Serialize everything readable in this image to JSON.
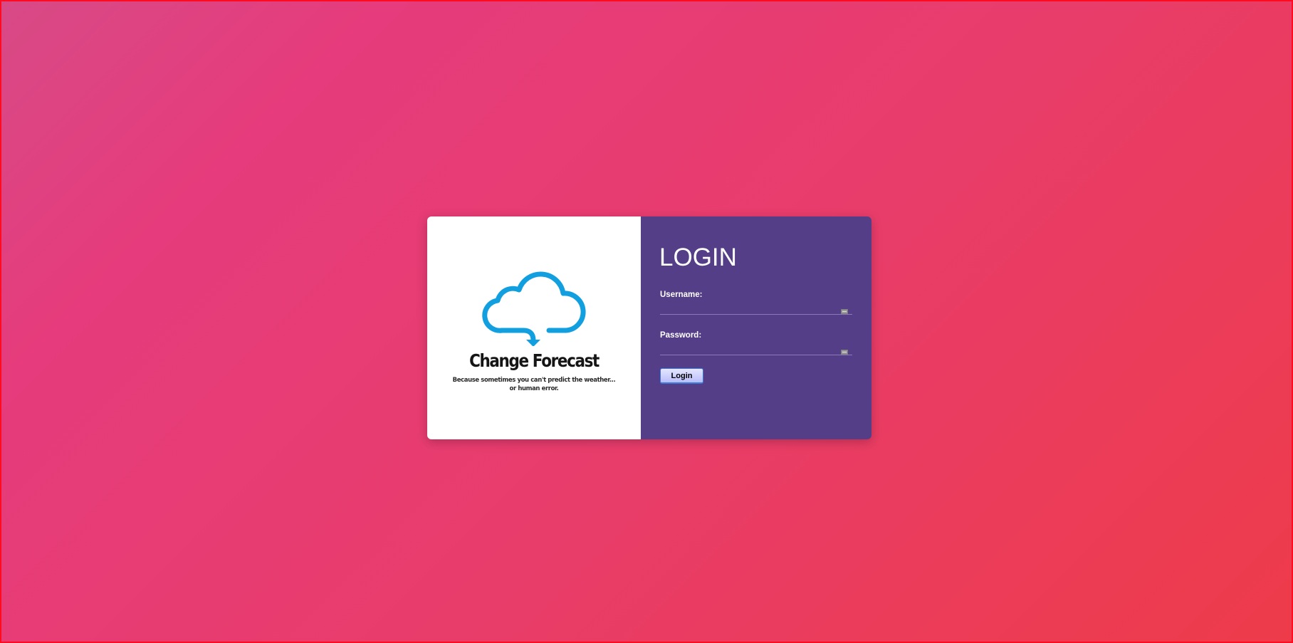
{
  "brand": {
    "name": "Change Forecast",
    "tagline_line1": "Because sometimes you can't predict the weather...",
    "tagline_line2": "or human error.",
    "logo_icon": "cloud-download-icon",
    "logo_color": "#119fe0"
  },
  "login_form": {
    "heading": "LOGIN",
    "username_label": "Username:",
    "username_value": "",
    "password_label": "Password:",
    "password_value": "",
    "submit_label": "Login"
  },
  "colors": {
    "background_gradient": [
      "#d84a86",
      "#e63b7c",
      "#ee3b4a"
    ],
    "form_panel": "#553e88",
    "brand_panel": "#ffffff",
    "frame_border": "#ff0a1e"
  }
}
